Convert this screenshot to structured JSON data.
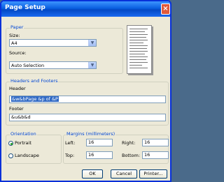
{
  "window": {
    "title": "Page Setup",
    "close_glyph": "×"
  },
  "paper": {
    "legend": "Paper",
    "size_label": "Size:",
    "size_value": "A4",
    "source_label": "Source:",
    "source_value": "Auto Selection"
  },
  "headers_footers": {
    "legend": "Headers and Footers",
    "header_label": "Header",
    "header_value": "&w&bPage &p of &P",
    "footer_label": "Footer",
    "footer_value": "&u&b&d"
  },
  "orientation": {
    "legend": "Orientation",
    "portrait_label": "Portrait",
    "landscape_label": "Landscape",
    "selected": "Portrait"
  },
  "margins": {
    "legend": "Margins (millimeters)",
    "left_label": "Left:",
    "left_value": "16",
    "right_label": "Right:",
    "right_value": "16",
    "top_label": "Top:",
    "top_value": "16",
    "bottom_label": "Bottom:",
    "bottom_value": "16"
  },
  "buttons": {
    "ok": "OK",
    "cancel": "Cancel",
    "printer": "Printer..."
  },
  "icons": {
    "dropdown": "chevron-down-icon",
    "close": "close-icon"
  },
  "colors": {
    "title_bar": "#0a5fe0",
    "dialog_bg": "#ece9d8",
    "group_label": "#0046d5",
    "selection": "#316ac5"
  }
}
